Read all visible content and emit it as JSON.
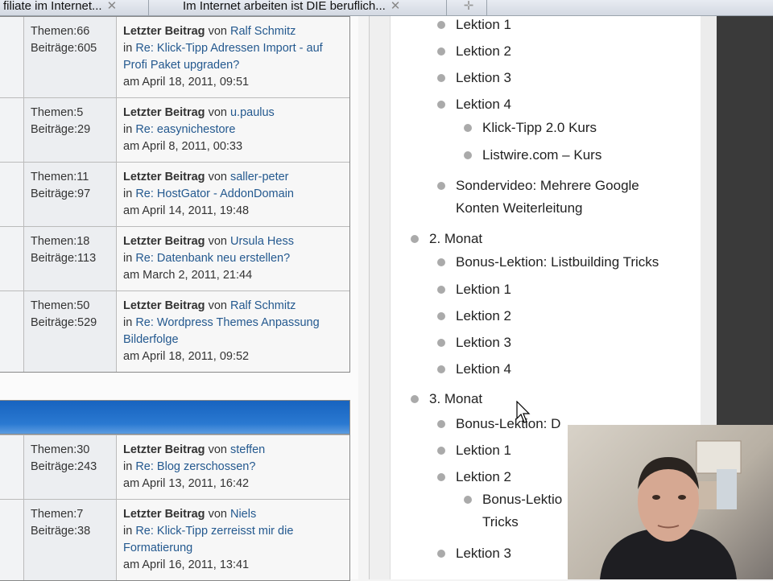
{
  "tabs": [
    {
      "label": "filiate im Internet..."
    },
    {
      "label": "Im Internet arbeiten ist DIE beruflich..."
    }
  ],
  "forum": {
    "group1": [
      {
        "themen": "Themen:66",
        "beitraege": "Beiträge:605",
        "author": "Ralf Schmitz",
        "topic": "Re: Klick-Tipp Adressen Import - auf Profi Paket upgraden?",
        "date": "am April 18, 2011, 09:51"
      },
      {
        "themen": "Themen:5",
        "beitraege": "Beiträge:29",
        "author": "u.paulus",
        "topic": "Re: easynichestore",
        "date": "am April 8, 2011, 00:33"
      },
      {
        "themen": "Themen:11",
        "beitraege": "Beiträge:97",
        "author": "saller-peter",
        "topic": "Re: HostGator - AddonDomain",
        "date": "am April 14, 2011, 19:48"
      },
      {
        "themen": "Themen:18",
        "beitraege": "Beiträge:113",
        "author": "Ursula Hess",
        "topic": "Re: Datenbank neu erstellen?",
        "date": "am March 2, 2011, 21:44"
      },
      {
        "themen": "Themen:50",
        "beitraege": "Beiträge:529",
        "author": "Ralf Schmitz",
        "topic": "Re: Wordpress Themes Anpassung Bilderfolge",
        "date": "am April 18, 2011, 09:52"
      }
    ],
    "group2": [
      {
        "themen": "Themen:30",
        "beitraege": "Beiträge:243",
        "author": "steffen",
        "topic": "Re: Blog zerschossen?",
        "date": "am April 13, 2011, 16:42"
      },
      {
        "themen": "Themen:7",
        "beitraege": "Beiträge:38",
        "author": "Niels",
        "topic": "Re: Klick-Tipp zerreisst mir die Formatierung",
        "date": "am April 16, 2011, 13:41"
      }
    ],
    "last_post_label": "Letzter Beitrag",
    "von": "von",
    "in": "in"
  },
  "list": [
    {
      "level": 2,
      "label": "Lektion 1"
    },
    {
      "level": 2,
      "label": "Lektion 2"
    },
    {
      "level": 2,
      "label": "Lektion 3"
    },
    {
      "level": 2,
      "label": "Lektion 4"
    },
    {
      "level": 3,
      "label": "Klick-Tipp 2.0 Kurs"
    },
    {
      "level": 3,
      "label": "Listwire.com – Kurs"
    },
    {
      "level": 2,
      "label": "Sondervideo: Mehrere Google Konten Weiterleitung"
    },
    {
      "level": 1,
      "label": "2. Monat"
    },
    {
      "level": 2,
      "label": "Bonus-Lektion: Listbuilding Tricks"
    },
    {
      "level": 2,
      "label": "Lektion 1"
    },
    {
      "level": 2,
      "label": "Lektion 2"
    },
    {
      "level": 2,
      "label": "Lektion 3"
    },
    {
      "level": 2,
      "label": "Lektion 4"
    },
    {
      "level": 1,
      "label": "3. Monat"
    },
    {
      "level": 2,
      "label": "Bonus-Lektion: D"
    },
    {
      "level": 2,
      "label": "Lektion 1"
    },
    {
      "level": 2,
      "label": "Lektion 2"
    },
    {
      "level": 3,
      "label": "Bonus-Lektio Tricks"
    },
    {
      "level": 2,
      "label": "Lektion 3"
    }
  ]
}
